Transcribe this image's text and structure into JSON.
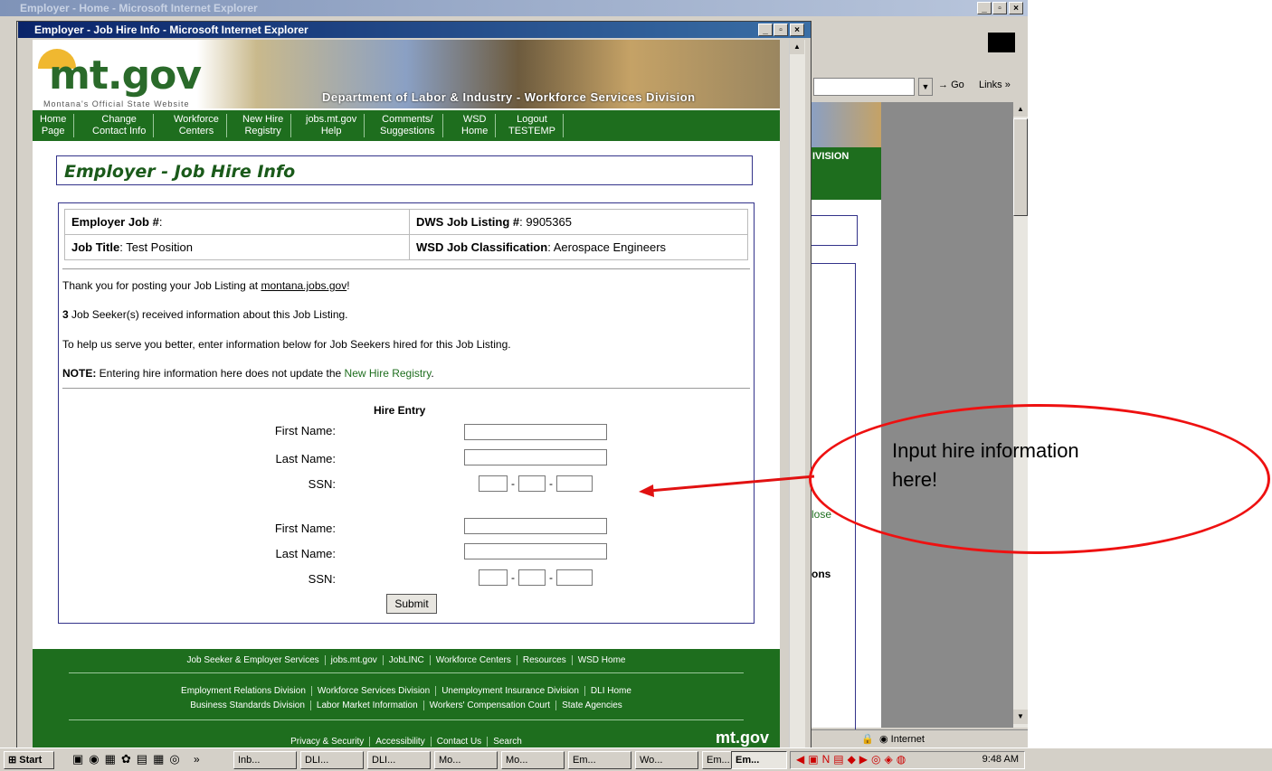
{
  "background_window": {
    "title": "Employer - Home - Microsoft Internet Explorer",
    "go_label": "Go",
    "links_label": "Links",
    "division_fragment": "IVISION",
    "close_fragment": "lose",
    "ons_fragment": "ons",
    "status_zone": "Internet"
  },
  "popup": {
    "title": "Employer - Job Hire Info - Microsoft Internet Explorer",
    "logo_text": "mt.gov",
    "logo_subtitle": "Montana's Official State Website",
    "department": "Department of Labor & Industry - Workforce Services Division",
    "nav": [
      {
        "line1": "Home",
        "line2": "Page"
      },
      {
        "line1": "Change",
        "line2": "Contact Info"
      },
      {
        "line1": "Workforce",
        "line2": "Centers"
      },
      {
        "line1": "New Hire",
        "line2": "Registry"
      },
      {
        "line1": "jobs.mt.gov",
        "line2": "Help"
      },
      {
        "line1": "Comments/",
        "line2": "Suggestions"
      },
      {
        "line1": "WSD",
        "line2": "Home"
      },
      {
        "line1": "Logout",
        "line2": "TESTEMP"
      }
    ],
    "page_title": "Employer - Job Hire Info",
    "info": {
      "employer_job_label": "Employer Job #",
      "employer_job_value": "",
      "dws_label": "DWS Job Listing #",
      "dws_value": "9905365",
      "job_title_label": "Job Title",
      "job_title_value": "Test Position",
      "wsd_label": "WSD Job Classification",
      "wsd_value": "Aerospace Engineers"
    },
    "messages": {
      "thanks_prefix": "Thank you for posting your Job Listing at ",
      "thanks_link": "montana.jobs.gov",
      "thanks_suffix": "!",
      "seekers_count": "3",
      "seekers_text": " Job Seeker(s) received information about this Job Listing.",
      "help_text": "To help us serve you better, enter information below for Job Seekers hired for this Job Listing.",
      "note_label": "NOTE:",
      "note_text": " Entering hire information here does not update the ",
      "note_link": "New Hire Registry",
      "note_end": "."
    },
    "hire_entry": {
      "heading": "Hire Entry",
      "first_name_label": "First Name:",
      "last_name_label": "Last Name:",
      "ssn_label": "SSN:",
      "ssn_sep": "-",
      "submit_label": "Submit"
    },
    "footer": {
      "row1": [
        "Job Seeker & Employer Services",
        "jobs.mt.gov",
        "JobLINC",
        "Workforce Centers",
        "Resources",
        "WSD Home"
      ],
      "row2": [
        "Employment Relations Division",
        "Workforce Services Division",
        "Unemployment Insurance Division",
        "DLI Home"
      ],
      "row3": [
        "Business Standards Division",
        "Labor Market Information",
        "Workers' Compensation Court",
        "State Agencies"
      ],
      "row4": [
        "Privacy & Security",
        "Accessibility",
        "Contact Us",
        "Search"
      ],
      "logo": "mt.gov"
    }
  },
  "annotation": {
    "line1": "Input hire information",
    "line2": "here!",
    "color": "#e11111"
  },
  "taskbar": {
    "start_label": "Start",
    "chevron": "»",
    "buttons": [
      "Inb...",
      "DLI...",
      "DLI...",
      "Mo...",
      "Mo...",
      "Em...",
      "Wo...",
      "Em...",
      "Em..."
    ],
    "clock": "9:48 AM"
  }
}
